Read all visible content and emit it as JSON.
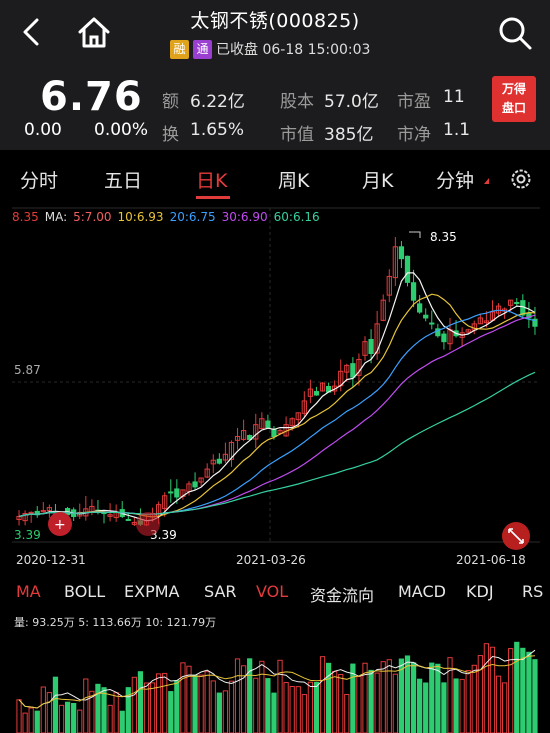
{
  "header": {
    "title": "太钢不锈(000825)",
    "tags": [
      "融",
      "通"
    ],
    "status": "已收盘 06-18 15:00:03"
  },
  "quote": {
    "price": "6.76",
    "change": "0.00",
    "change_pct": "0.00%",
    "amount_label": "额",
    "amount": "6.22亿",
    "turnover_label": "换",
    "turnover": "1.65%",
    "share_capital_label": "股本",
    "share_capital": "57.0亿",
    "market_value_label": "市值",
    "market_value": "385亿",
    "pe_label": "市盈",
    "pe": "11",
    "pb_label": "市净",
    "pb": "1.1",
    "badge_line1": "万得",
    "badge_line2": "盘口"
  },
  "tabs": [
    "分时",
    "五日",
    "日K",
    "周K",
    "月K",
    "分钟"
  ],
  "active_tab": "日K",
  "ma_legend": {
    "max": "8.35",
    "label": "MA:",
    "ma5": "5:7.00",
    "ma10": "10:6.93",
    "ma20": "20:6.75",
    "ma30": "30:6.90",
    "ma60": "60:6.16"
  },
  "colors": {
    "up": "#e23b3b",
    "down": "#2ecc71",
    "ma5": "#f4f4f4",
    "ma10": "#e8c43a",
    "ma20": "#3aa0ff",
    "ma30": "#c04cf0",
    "ma60": "#35d0a0"
  },
  "chart_data": {
    "type": "candlestick",
    "price_labels": {
      "max": "8.35",
      "mid": "5.87",
      "min_left": "3.39",
      "min_marker": "3.39",
      "high_marker": "8.35"
    },
    "dates": [
      "2020-12-31",
      "2021-03-26",
      "2021-06-18"
    ],
    "ylim": [
      3.39,
      8.35
    ],
    "close_path": [
      3.55,
      3.6,
      3.62,
      3.58,
      3.65,
      3.7,
      3.62,
      3.6,
      3.58,
      3.55,
      3.62,
      3.68,
      3.72,
      3.65,
      3.6,
      3.58,
      3.62,
      3.55,
      3.5,
      3.45,
      3.42,
      3.48,
      3.6,
      3.75,
      3.9,
      3.95,
      3.88,
      4.0,
      4.1,
      4.05,
      4.2,
      4.35,
      4.5,
      4.45,
      4.6,
      4.8,
      4.9,
      5.0,
      4.85,
      5.1,
      5.2,
      5.05,
      4.9,
      5.0,
      5.1,
      5.2,
      5.3,
      5.5,
      5.7,
      5.6,
      5.8,
      5.65,
      5.75,
      6.0,
      6.1,
      5.9,
      6.2,
      6.5,
      6.3,
      6.8,
      7.2,
      7.6,
      8.1,
      7.9,
      7.5,
      7.2,
      7.0,
      6.9,
      6.8,
      6.6,
      6.5,
      6.7,
      6.6,
      6.65,
      6.7,
      6.8,
      6.9,
      6.85,
      7.0,
      7.1,
      7.05,
      7.2,
      7.15,
      6.95,
      6.9,
      6.76
    ]
  },
  "indicator_tabs": [
    "MA",
    "BOLL",
    "EXPMA",
    "SAR",
    "VOL",
    "资金流向",
    "MACD",
    "KDJ",
    "RS"
  ],
  "volume_legend": "量: 93.25万  5: 113.66万  10: 121.79万"
}
